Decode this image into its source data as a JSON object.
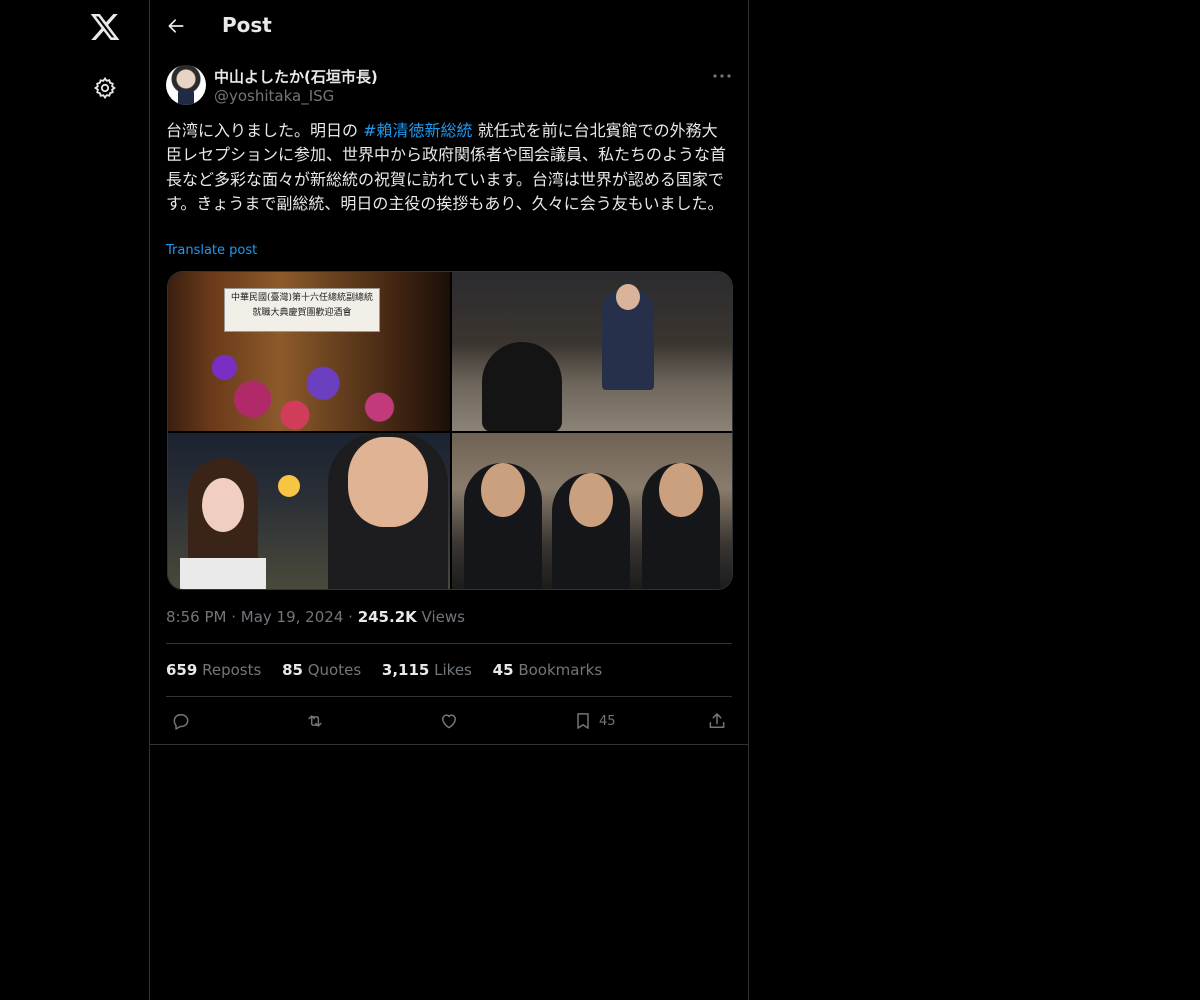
{
  "nav": {
    "logo_icon": "x-logo-icon",
    "settings_icon": "gear-icon"
  },
  "header": {
    "title": "Post",
    "back_icon": "arrow-left-icon"
  },
  "author": {
    "display_name": "中山よしたか(石垣市長)",
    "handle": "@yoshitaka_ISG"
  },
  "post": {
    "text_before": "台湾に入りました。明日の ",
    "hashtag": "#賴清徳新総統",
    "text_after": " 就任式を前に台北賓館での外務大臣レセプションに参加、世界中から政府関係者や国会議員、私たちのような首長など多彩な面々が新総統の祝賀に訪れています。台湾は世界が認める国家です。きょうまで副総統、明日の主役の挨拶もあり、久々に会う友もいました。",
    "translate_label": "Translate post",
    "photo1_caption_line1": "中華民國(臺灣)第十六任總統副總統",
    "photo1_caption_line2": "就職大典慶賀團歡迎酒會"
  },
  "meta": {
    "time": "8:56 PM",
    "date": "May 19, 2024",
    "views_count": "245.2K",
    "views_label": "Views"
  },
  "stats": {
    "reposts_count": "659",
    "reposts_label": "Reposts",
    "quotes_count": "85",
    "quotes_label": "Quotes",
    "likes_count": "3,115",
    "likes_label": "Likes",
    "bookmarks_count": "45",
    "bookmarks_label": "Bookmarks"
  },
  "actions": {
    "reply_icon": "reply-icon",
    "repost_icon": "repost-icon",
    "like_icon": "heart-icon",
    "bookmark_icon": "bookmark-icon",
    "bookmark_count": "45",
    "share_icon": "share-icon"
  },
  "colors": {
    "accent": "#1d9bf0",
    "text": "#e7e9ea",
    "muted": "#71767b",
    "border": "#2f3336",
    "background": "#000000"
  }
}
